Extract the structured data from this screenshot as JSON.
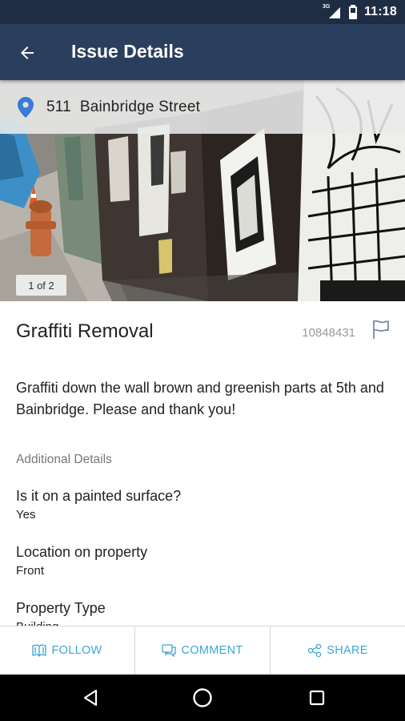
{
  "status_bar": {
    "time": "11:18",
    "network_label": "3G",
    "icons": [
      "signal-icon",
      "battery-icon"
    ]
  },
  "app_bar": {
    "title": "Issue Details",
    "back_icon": "arrow-left-icon"
  },
  "photo": {
    "address": "511  Bainbridge Street",
    "location_icon": "map-pin-icon",
    "counter": "1 of 2"
  },
  "issue": {
    "title": "Graffiti Removal",
    "id": "10848431",
    "flag_icon": "flag-icon",
    "description": "Graffiti down the wall brown and greenish parts at 5th and Bainbridge. Please and thank you!"
  },
  "additional": {
    "label": "Additional Details",
    "items": [
      {
        "question": "Is it on a painted surface?",
        "answer": "Yes"
      },
      {
        "question": "Location on property",
        "answer": "Front"
      },
      {
        "question": "Property Type",
        "answer": "Building"
      }
    ]
  },
  "actions": [
    {
      "label": "FOLLOW",
      "icon": "book-icon"
    },
    {
      "label": "COMMENT",
      "icon": "comment-icon"
    },
    {
      "label": "SHARE",
      "icon": "share-icon"
    }
  ],
  "colors": {
    "status_bar": "#1f2d44",
    "app_bar": "#2a3f5e",
    "accent": "#3ba6d6",
    "pin": "#3a7bd5"
  },
  "nav_bar": {
    "icons": [
      "back-triangle-icon",
      "home-circle-icon",
      "recents-square-icon"
    ]
  }
}
